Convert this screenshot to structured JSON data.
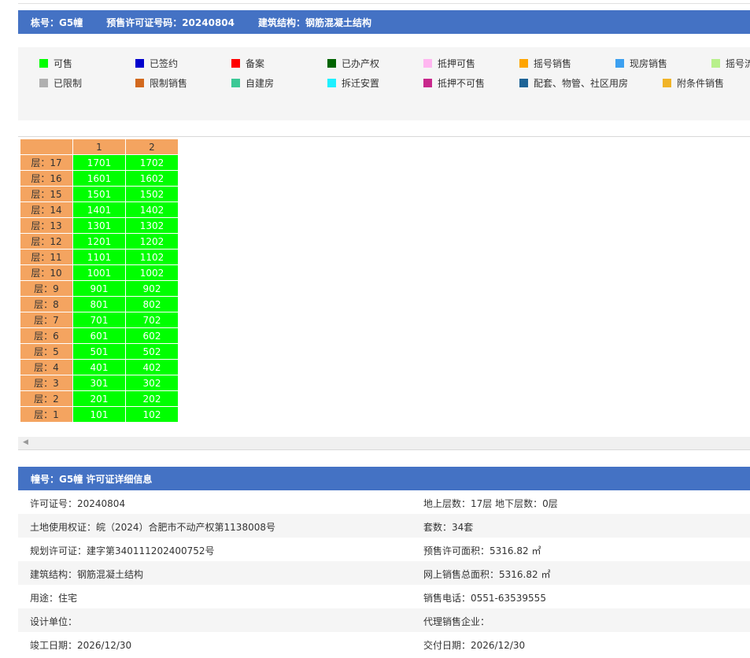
{
  "header": {
    "building": "栋号：G5幢",
    "permit": "预售许可证号码：20240804",
    "structure": "建筑结构：钢筋混凝土结构"
  },
  "legend": [
    {
      "label": "可售",
      "color": "#00ff00"
    },
    {
      "label": "已签约",
      "color": "#0000cd"
    },
    {
      "label": "备案",
      "color": "#ff0000"
    },
    {
      "label": "已办产权",
      "color": "#006400"
    },
    {
      "label": "抵押可售",
      "color": "#ffb6f0"
    },
    {
      "label": "摇号销售",
      "color": "#ffa500"
    },
    {
      "label": "现房销售",
      "color": "#3ca0f0"
    },
    {
      "label": "摇号流",
      "color": "#b8f08c"
    },
    {
      "label": "已限制",
      "color": "#b0b0b0"
    },
    {
      "label": "限制销售",
      "color": "#d2691e"
    },
    {
      "label": "自建房",
      "color": "#3cc896"
    },
    {
      "label": "拆迁安置",
      "color": "#1ef0ff"
    },
    {
      "label": "抵押不可售",
      "color": "#c8288c"
    },
    {
      "label": "配套、物管、社区用房",
      "color": "#1e6496"
    },
    {
      "label": "附条件销售",
      "color": "#f0b428"
    }
  ],
  "grid": {
    "columns": [
      "1",
      "2"
    ],
    "rows": [
      {
        "floor": "层：17",
        "units": [
          "1701",
          "1702"
        ]
      },
      {
        "floor": "层：16",
        "units": [
          "1601",
          "1602"
        ]
      },
      {
        "floor": "层：15",
        "units": [
          "1501",
          "1502"
        ]
      },
      {
        "floor": "层：14",
        "units": [
          "1401",
          "1402"
        ]
      },
      {
        "floor": "层：13",
        "units": [
          "1301",
          "1302"
        ]
      },
      {
        "floor": "层：12",
        "units": [
          "1201",
          "1202"
        ]
      },
      {
        "floor": "层：11",
        "units": [
          "1101",
          "1102"
        ]
      },
      {
        "floor": "层：10",
        "units": [
          "1001",
          "1002"
        ]
      },
      {
        "floor": "层：9",
        "units": [
          "901",
          "902"
        ]
      },
      {
        "floor": "层：8",
        "units": [
          "801",
          "802"
        ]
      },
      {
        "floor": "层：7",
        "units": [
          "701",
          "702"
        ]
      },
      {
        "floor": "层：6",
        "units": [
          "601",
          "602"
        ]
      },
      {
        "floor": "层：5",
        "units": [
          "501",
          "502"
        ]
      },
      {
        "floor": "层：4",
        "units": [
          "401",
          "402"
        ]
      },
      {
        "floor": "层：3",
        "units": [
          "301",
          "302"
        ]
      },
      {
        "floor": "层：2",
        "units": [
          "201",
          "202"
        ]
      },
      {
        "floor": "层：1",
        "units": [
          "101",
          "102"
        ]
      }
    ]
  },
  "detail": {
    "title": "幢号：G5幢 许可证详细信息",
    "rows": [
      {
        "left": "许可证号：20240804",
        "right": "地上层数：17层 地下层数：0层"
      },
      {
        "left": "土地使用权证：皖（2024）合肥市不动产权第1138008号",
        "right": "套数：34套"
      },
      {
        "left": "规划许可证：建字第340111202400752号",
        "right": "预售许可面积：5316.82 ㎡"
      },
      {
        "left": "建筑结构：钢筋混凝土结构",
        "right": "网上销售总面积：5316.82 ㎡"
      },
      {
        "left": "用途：住宅",
        "right": "销售电话：0551-63539555"
      },
      {
        "left": "设计单位：",
        "right": "代理销售企业："
      },
      {
        "left": "竣工日期：2026/12/30",
        "right": "交付日期：2026/12/30"
      }
    ]
  }
}
